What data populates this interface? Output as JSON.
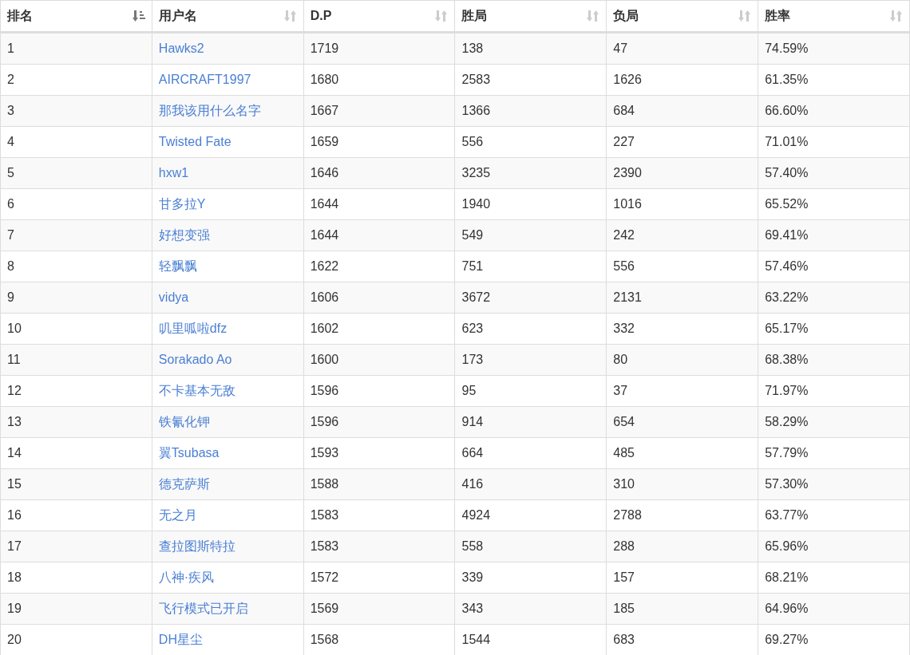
{
  "table": {
    "columns": [
      {
        "label": "排名",
        "sorted": true
      },
      {
        "label": "用户名",
        "sorted": false
      },
      {
        "label": "D.P",
        "sorted": false
      },
      {
        "label": "胜局",
        "sorted": false
      },
      {
        "label": "负局",
        "sorted": false
      },
      {
        "label": "胜率",
        "sorted": false
      }
    ],
    "rows": [
      [
        "1",
        "Hawks2",
        "1719",
        "138",
        "47",
        "74.59%"
      ],
      [
        "2",
        "AIRCRAFT1997",
        "1680",
        "2583",
        "1626",
        "61.35%"
      ],
      [
        "3",
        "那我该用什么名字",
        "1667",
        "1366",
        "684",
        "66.60%"
      ],
      [
        "4",
        "Twisted Fate",
        "1659",
        "556",
        "227",
        "71.01%"
      ],
      [
        "5",
        "hxw1",
        "1646",
        "3235",
        "2390",
        "57.40%"
      ],
      [
        "6",
        "甘多拉Y",
        "1644",
        "1940",
        "1016",
        "65.52%"
      ],
      [
        "7",
        "好想变强",
        "1644",
        "549",
        "242",
        "69.41%"
      ],
      [
        "8",
        "轻飘飘",
        "1622",
        "751",
        "556",
        "57.46%"
      ],
      [
        "9",
        "vidya",
        "1606",
        "3672",
        "2131",
        "63.22%"
      ],
      [
        "10",
        "叽里呱啦dfz",
        "1602",
        "623",
        "332",
        "65.17%"
      ],
      [
        "11",
        "Sorakado Ao",
        "1600",
        "173",
        "80",
        "68.38%"
      ],
      [
        "12",
        "不卡基本无敌",
        "1596",
        "95",
        "37",
        "71.97%"
      ],
      [
        "13",
        "铁氰化钾",
        "1596",
        "914",
        "654",
        "58.29%"
      ],
      [
        "14",
        "翼Tsubasa",
        "1593",
        "664",
        "485",
        "57.79%"
      ],
      [
        "15",
        "德克萨斯",
        "1588",
        "416",
        "310",
        "57.30%"
      ],
      [
        "16",
        "无之月",
        "1583",
        "4924",
        "2788",
        "63.77%"
      ],
      [
        "17",
        "查拉图斯特拉",
        "1583",
        "558",
        "288",
        "65.96%"
      ],
      [
        "18",
        "八神·疾风",
        "1572",
        "339",
        "157",
        "68.21%"
      ],
      [
        "19",
        "飞行模式已开启",
        "1569",
        "343",
        "185",
        "64.96%"
      ],
      [
        "20",
        "DH星尘",
        "1568",
        "1544",
        "683",
        "69.27%"
      ]
    ]
  }
}
